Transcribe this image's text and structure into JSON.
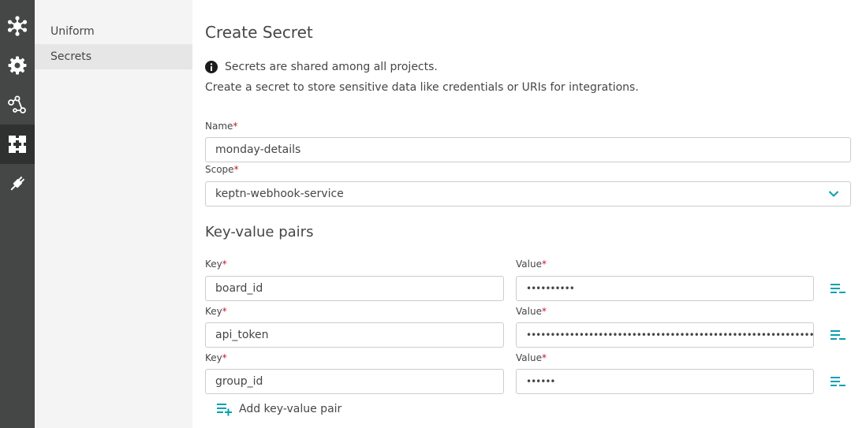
{
  "sidebar": {
    "icons": [
      {
        "icon": "keptn-logo-icon"
      },
      {
        "icon": "gear-icon"
      },
      {
        "icon": "sequence-icon"
      },
      {
        "icon": "integrations-icon",
        "active": true
      },
      {
        "icon": "plug-icon"
      }
    ]
  },
  "subnav": {
    "items": [
      {
        "label": "Uniform"
      },
      {
        "label": "Secrets",
        "active": true
      }
    ]
  },
  "main": {
    "title": "Create Secret",
    "info_text": "Secrets are shared among all projects.",
    "description": "Create a secret to store sensitive data like credentials or URIs for integrations.",
    "name_label": "Name",
    "name_value": "monday-details",
    "scope_label": "Scope",
    "scope_value": "keptn-webhook-service",
    "required_marker": "*",
    "kv_title": "Key-value pairs",
    "key_label": "Key",
    "value_label": "Value",
    "pairs": [
      {
        "key": "board_id",
        "value_masked": "••••••••••"
      },
      {
        "key": "api_token",
        "value_masked": "••••••••••••••••••••••••••••••••••••••••••••••••••••••••••••••••••••••••••"
      },
      {
        "key": "group_id",
        "value_masked": "••••••"
      }
    ],
    "add_pair_label": "Add key-value pair"
  },
  "colors": {
    "rail": "#454646",
    "rail_active": "#2f3030",
    "subnav": "#f4f4f4",
    "accent": "#00a1b2",
    "required": "#c41425"
  }
}
